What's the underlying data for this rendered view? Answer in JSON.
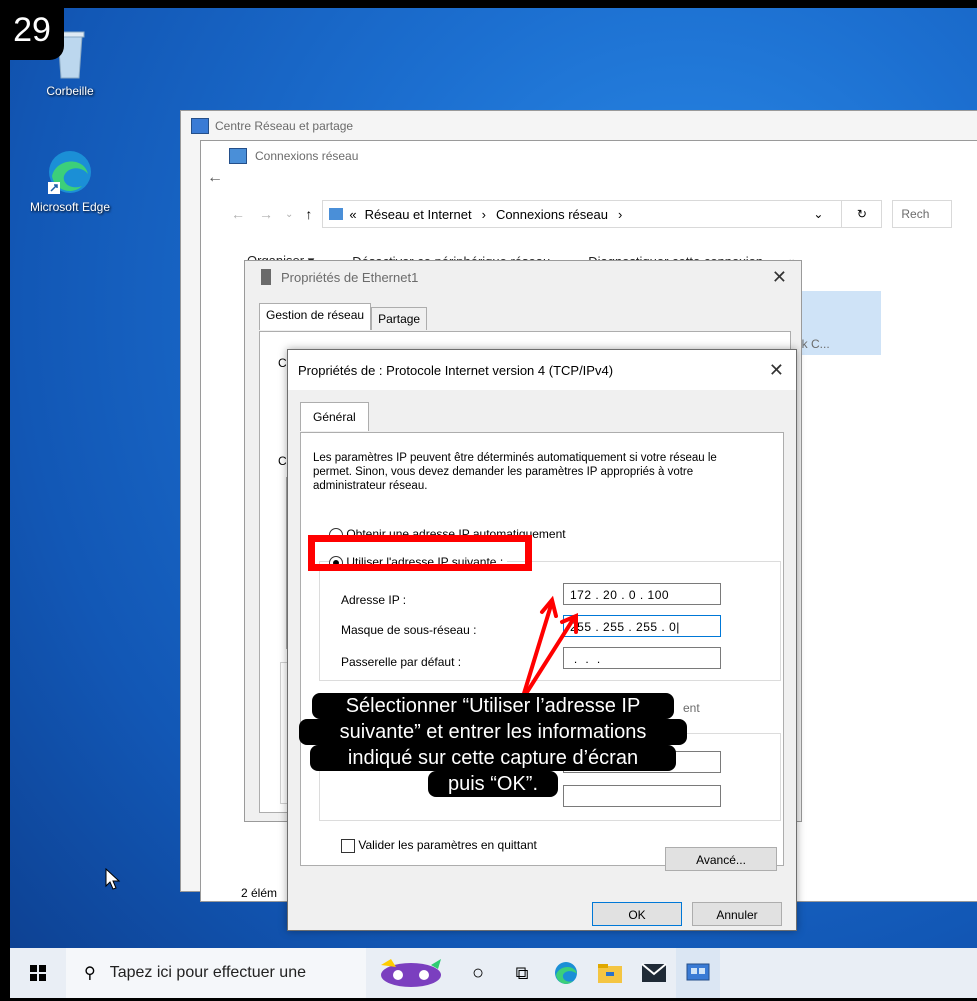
{
  "step_number": "29",
  "desktop": {
    "icons": [
      {
        "label": "Corbeille",
        "icon": "recycle-bin-icon"
      },
      {
        "label": "Microsoft Edge",
        "icon": "edge-icon"
      }
    ]
  },
  "network_center": {
    "title": "Centre Réseau et partage"
  },
  "connections": {
    "title": "Connexions réseau",
    "breadcrumb_prefix": "«",
    "breadcrumb": [
      "Réseau et Internet",
      "Connexions réseau"
    ],
    "search_placeholder": "Rech",
    "toolbar": [
      "Organiser ▾",
      "Désactiver ce périphérique réseau",
      "Diagnostiquer cette connexion",
      "»"
    ],
    "adapter_text": "twork C...",
    "status": "2 élém"
  },
  "ethernet_props": {
    "title": "Propriétés de Ethernet1",
    "tabs": [
      "Gestion de réseau",
      "Partage"
    ],
    "labels": [
      "Co",
      "Ce"
    ],
    "close": "✕"
  },
  "ipv4": {
    "title": "Propriétés de : Protocole Internet version 4 (TCP/IPv4)",
    "close": "✕",
    "tab": "Général",
    "description": "Les paramètres IP peuvent être déterminés automatiquement si votre réseau le permet. Sinon, vous devez demander les paramètres IP appropriés à votre administrateur réseau.",
    "radio_auto": "Obtenir une adresse IP automatiquement",
    "radio_manual": "Utiliser l'adresse IP suivante :",
    "fields": [
      {
        "label": "Adresse IP :",
        "value": "172 . 20 . 0 . 100"
      },
      {
        "label": "Masque de sous-réseau :",
        "value": "255 . 255 . 255 . 0|"
      },
      {
        "label": "Passerelle par défaut :",
        "value": " .  .  . "
      }
    ],
    "dns_partial": "ent",
    "validate_label": "Valider les paramètres en quittant",
    "advanced_button": "Avancé...",
    "ok_button": "OK",
    "cancel_button": "Annuler"
  },
  "callout": {
    "lines": [
      "Sélectionner “Utiliser l’adresse IP",
      "suivante” et entrer les informations",
      "indiqué sur cette capture d’écran",
      "puis “OK”."
    ]
  },
  "taskbar": {
    "search_placeholder": "Tapez ici pour effectuer une"
  },
  "colors": {
    "highlight": "#ff0000",
    "accent": "#0078d7"
  }
}
